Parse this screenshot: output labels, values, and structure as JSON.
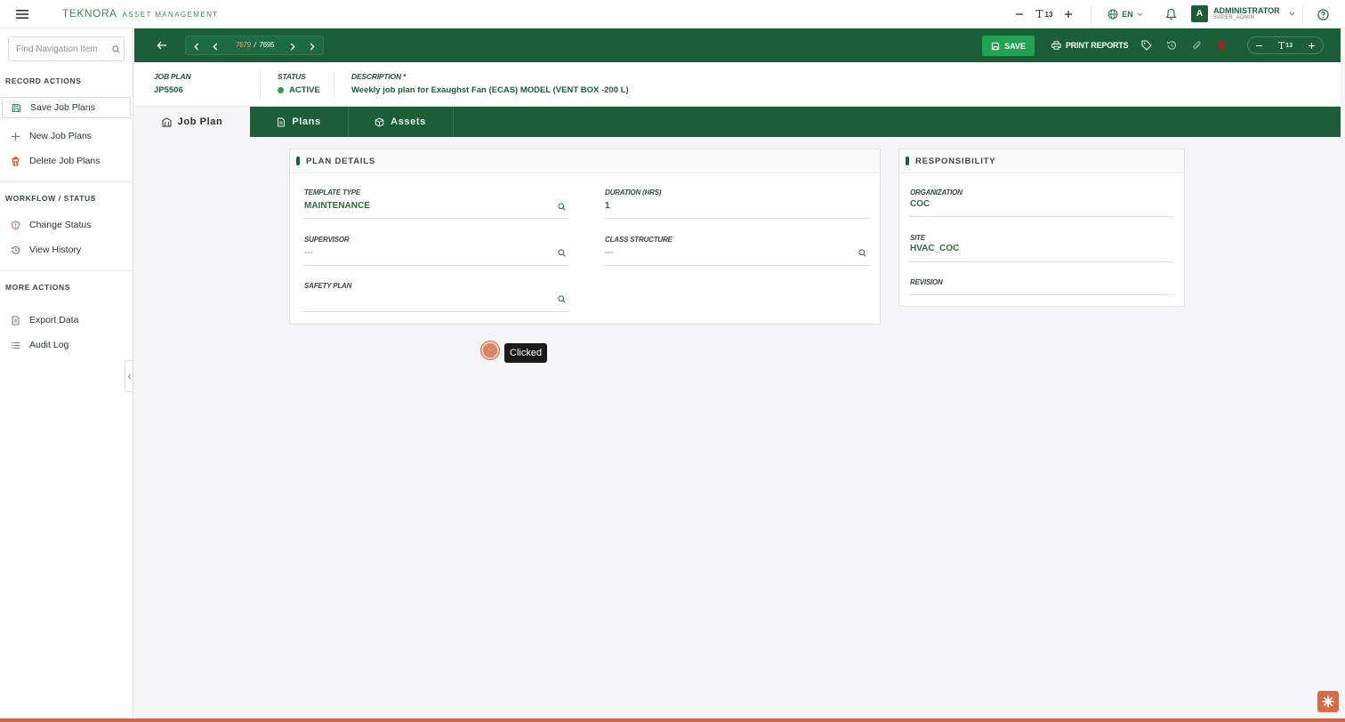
{
  "app": {
    "brand_name": "TEKNORA",
    "brand_sub": "ASSET MANAGEMENT",
    "font_size": "13",
    "language": "EN",
    "user_initial": "A",
    "user_name": "ADMINISTRATOR",
    "user_role": "SUPER_ADMIN"
  },
  "sidebar": {
    "search_placeholder": "Find Navigation Item",
    "sections": {
      "record_actions": "RECORD ACTIONS",
      "workflow": "WORKFLOW / STATUS",
      "more": "MORE ACTIONS"
    },
    "items": {
      "save": "Save Job Plans",
      "new": "New Job Plans",
      "delete": "Delete Job Plans",
      "change_status": "Change Status",
      "view_history": "View History",
      "export": "Export Data",
      "audit": "Audit Log"
    }
  },
  "toolbar": {
    "current_record": "7679",
    "separator": "/",
    "total_records": "7695",
    "save_label": "SAVE",
    "print_label": "PRINT REPORTS",
    "zoom_value": "13"
  },
  "record": {
    "job_plan_label": "JOB PLAN",
    "job_plan_value": "JP5506",
    "status_label": "STATUS",
    "status_value": "ACTIVE",
    "description_label": "DESCRIPTION *",
    "description_value": "Weekly job plan for Exaughst Fan (ECAS) MODEL (VENT BOX -200 L)"
  },
  "tabs": {
    "job_plan": "Job Plan",
    "plans": "Plans",
    "assets": "Assets"
  },
  "plan_details": {
    "title": "PLAN DETAILS",
    "template_type_label": "TEMPLATE TYPE",
    "template_type_value": "MAINTENANCE",
    "duration_label": "DURATION (HRS)",
    "duration_value": "1",
    "supervisor_label": "SUPERVISOR",
    "supervisor_value": "---",
    "class_structure_label": "CLASS STRUCTURE",
    "class_structure_value": "---",
    "safety_plan_label": "SAFETY PLAN",
    "safety_plan_value": ""
  },
  "responsibility": {
    "title": "RESPONSIBILITY",
    "organization_label": "ORGANIZATION",
    "organization_value": "COC",
    "site_label": "SITE",
    "site_value": "HVAC_COC",
    "revision_label": "REVISION",
    "revision_value": ""
  },
  "overlay": {
    "click_label": "Clicked"
  },
  "colors": {
    "primary": "#1b5e38",
    "accent_green": "#23a253",
    "status_active": "#2f9b5a",
    "delete_red": "#c0392b",
    "marker": "#d98466"
  }
}
